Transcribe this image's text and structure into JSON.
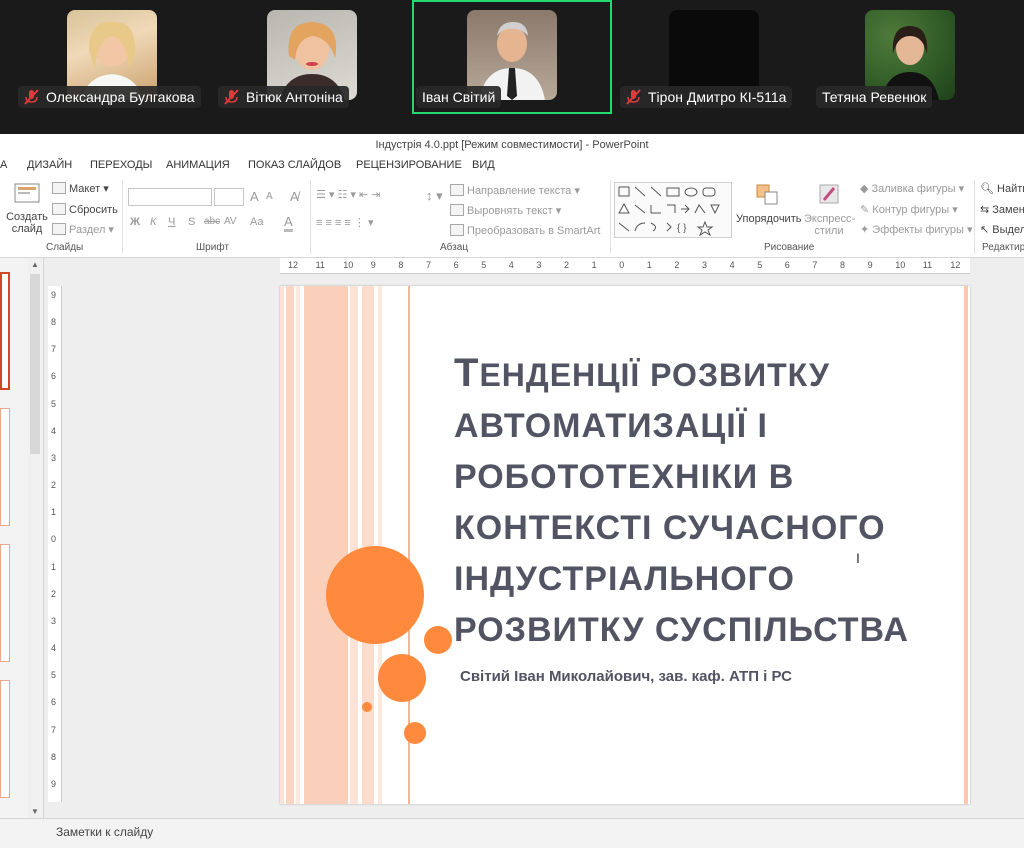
{
  "participants": [
    {
      "name": "Олександра Булгакова",
      "muted": true,
      "active": false
    },
    {
      "name": "Вітюк Антоніна",
      "muted": true,
      "active": false
    },
    {
      "name": "Іван Світий",
      "muted": false,
      "active": true
    },
    {
      "name": "Тірон Дмитро КІ-511а",
      "muted": true,
      "active": false
    },
    {
      "name": "Тетяна Ревенюк",
      "muted": false,
      "active": false
    }
  ],
  "window": {
    "title": "Індустрія 4.0.ppt [Режим совместимости] - PowerPoint"
  },
  "tabs": [
    "А",
    "ДИЗАЙН",
    "ПЕРЕХОДЫ",
    "АНИМАЦИЯ",
    "ПОКАЗ СЛАЙДОВ",
    "РЕЦЕНЗИРОВАНИЕ",
    "ВИД"
  ],
  "ribbon": {
    "slides": {
      "create_label": "Создать",
      "create_label2": "слайд",
      "layout": "Макет",
      "reset": "Сбросить",
      "section": "Раздел",
      "group": "Слайды"
    },
    "font": {
      "bold": "Ж",
      "italic": "К",
      "underline": "Ч",
      "shadow": "S",
      "strike": "abc",
      "spacing": "AV",
      "case": "Aa",
      "color": "A",
      "grow": "A",
      "shrink": "A",
      "group": "Шрифт"
    },
    "paragraph": {
      "text_direction": "Направление текста",
      "align_text": "Выровнять текст",
      "smartart": "Преобразовать в SmartArt",
      "group": "Абзац"
    },
    "drawing": {
      "arrange": "Упорядочить",
      "quick_styles": "Экспресс-",
      "quick_styles2": "стили",
      "fill": "Заливка фигуры",
      "outline": "Контур фигуры",
      "effects": "Эффекты фигуры",
      "group": "Рисование"
    },
    "editing": {
      "find": "Найти",
      "replace": "Замен",
      "select": "Выдел",
      "group": "Редактиро"
    }
  },
  "ruler": {
    "h_ticks": [
      "12",
      "11",
      "10",
      "9",
      "8",
      "7",
      "6",
      "5",
      "4",
      "3",
      "2",
      "1",
      "0",
      "1",
      "2",
      "3",
      "4",
      "5",
      "6",
      "7",
      "8",
      "9",
      "10",
      "11",
      "12"
    ],
    "v_ticks": [
      "9",
      "8",
      "7",
      "6",
      "5",
      "4",
      "3",
      "2",
      "1",
      "0",
      "1",
      "2",
      "3",
      "4",
      "5",
      "6",
      "7",
      "8",
      "9"
    ]
  },
  "slide": {
    "title_lines": [
      "Тенденції розвитку",
      "автоматизації і",
      "робототехніки в",
      "контексті сучасного",
      "індустріального",
      "розвитку суспільства"
    ],
    "subtitle": "Світий Іван Миколайович, зав. каф. АТП і РС"
  },
  "notes": {
    "placeholder": "Заметки к слайду"
  },
  "colors": {
    "accent_orange": "#ff8a3d",
    "title_gray": "#525363",
    "active_border": "#23d96f",
    "mute_red": "#e03b3b"
  }
}
